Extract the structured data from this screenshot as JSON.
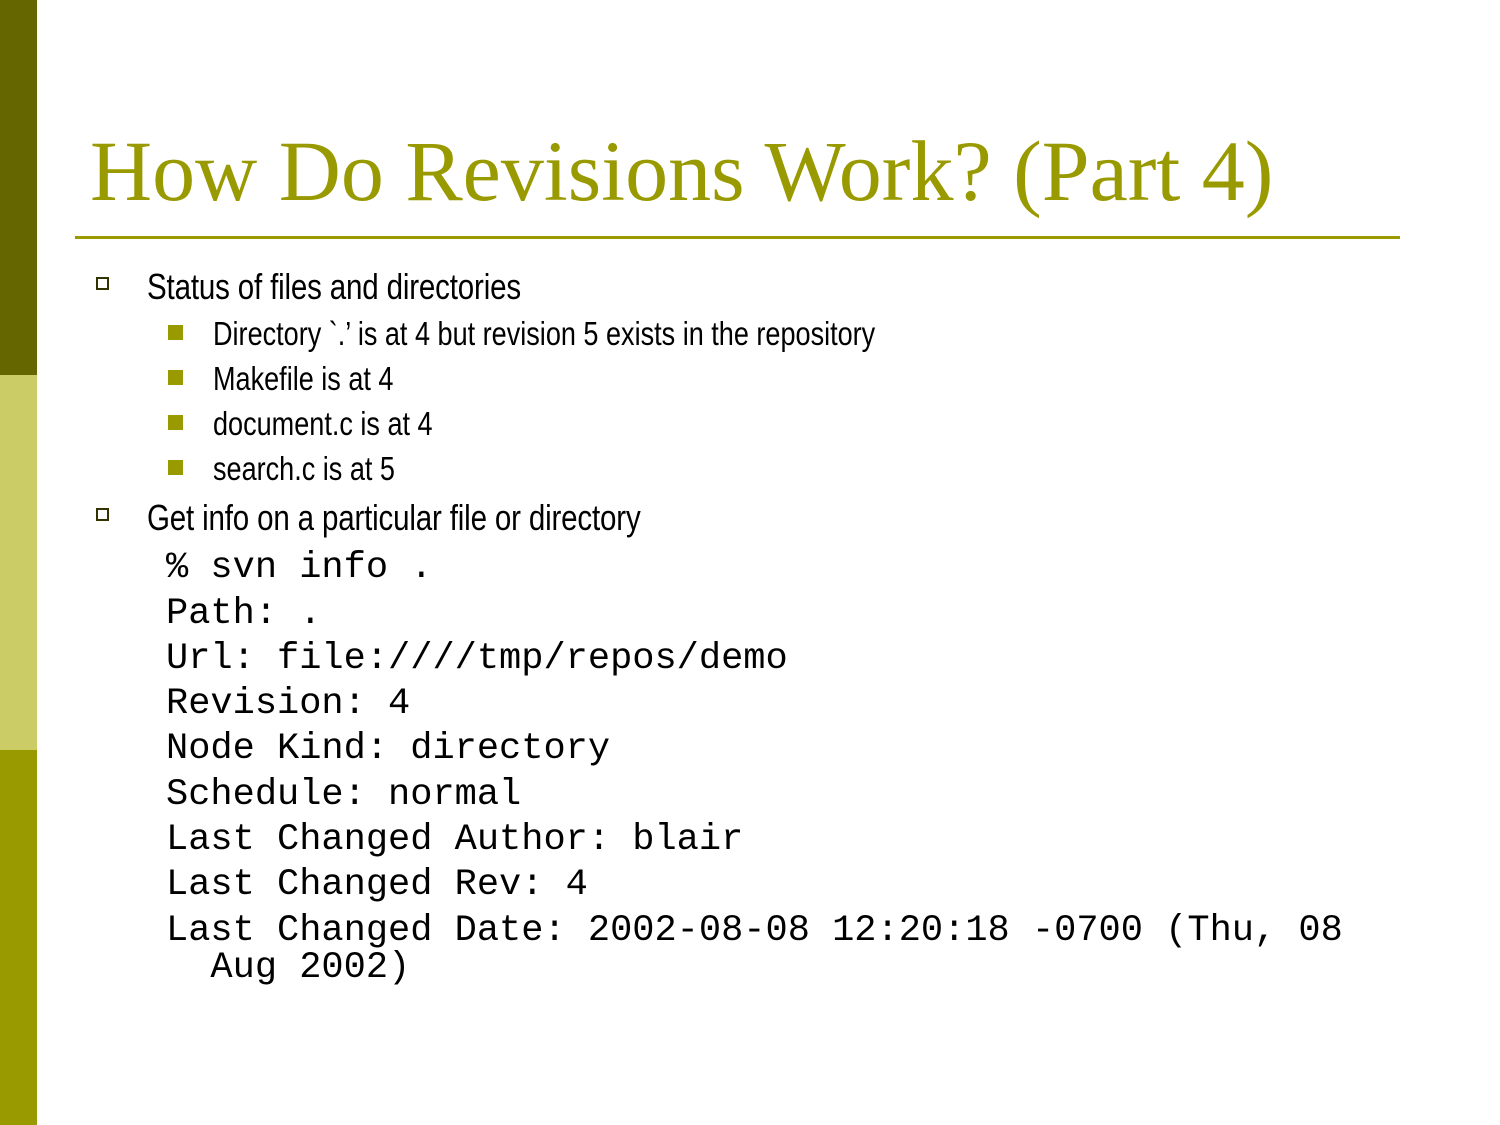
{
  "slide": {
    "title": "How Do Revisions Work? (Part 4)",
    "bullets": [
      {
        "text": "Status of files and directories",
        "sub": [
          "Directory `.’ is at 4 but revision 5 exists in the repository",
          "Makefile is at 4",
          "document.c is at 4",
          "search.c is at 5"
        ]
      },
      {
        "text": "Get info on a particular file or directory"
      }
    ],
    "code": [
      "% svn info .",
      "Path: .",
      "Url: file:////tmp/repos/demo",
      "Revision: 4",
      "Node Kind: directory",
      "Schedule: normal",
      "Last Changed Author: blair",
      "Last Changed Rev: 4",
      "Last Changed Date: 2002-08-08 12:20:18 -0700 (Thu, 08",
      "  Aug 2002)"
    ]
  },
  "colors": {
    "accent": "#999900",
    "bar_top": "#666600",
    "bar_mid": "#cccc66",
    "bar_bottom": "#999900"
  }
}
